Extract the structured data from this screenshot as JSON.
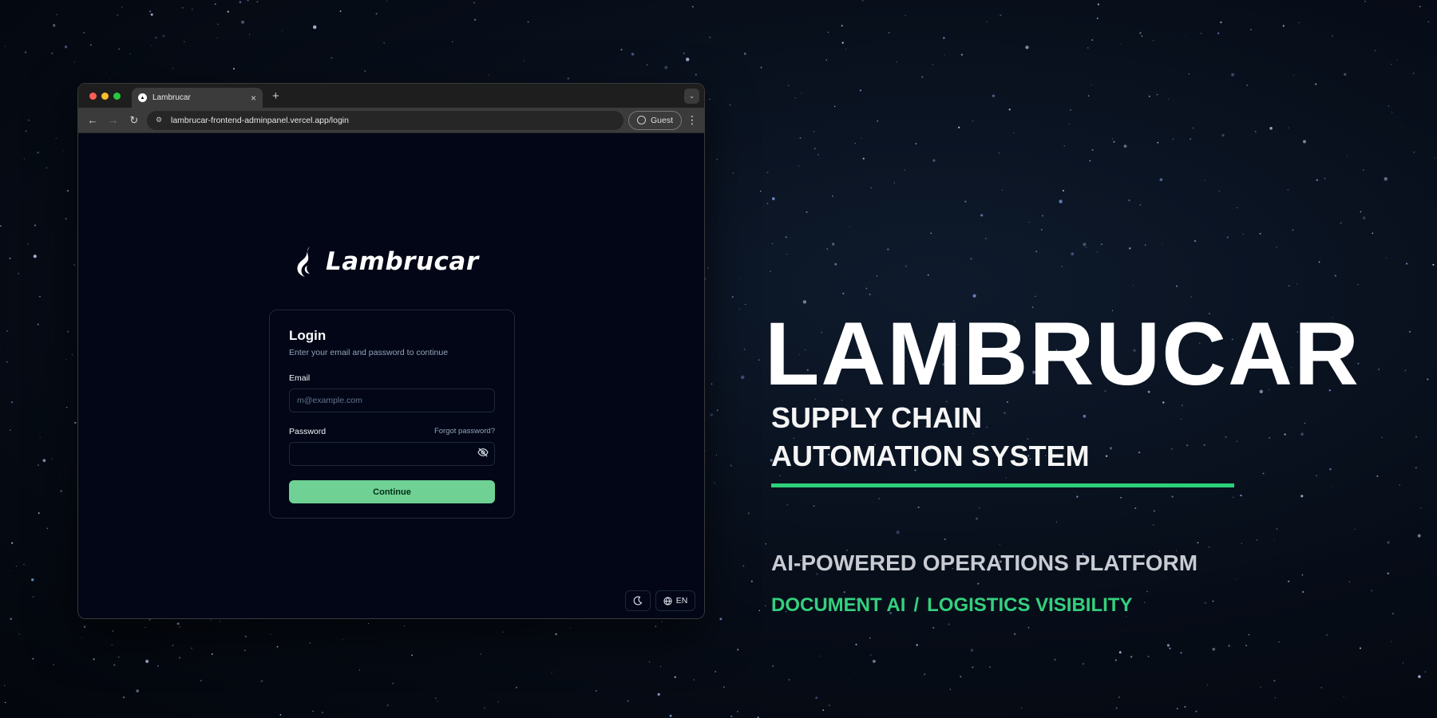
{
  "browser": {
    "tab_title": "Lambrucar",
    "tab_close": "×",
    "new_tab": "+",
    "url": "lambrucar-frontend-adminpanel.vercel.app/login",
    "profile_label": "Guest"
  },
  "login_page": {
    "brand_name": "Lambrucar",
    "title": "Login",
    "subtitle": "Enter your email and password to continue",
    "email_label": "Email",
    "email_placeholder": "m@example.com",
    "password_label": "Password",
    "forgot_password": "Forgot password?",
    "continue_label": "Continue",
    "language_label": "EN"
  },
  "hero": {
    "title": "LAMBRUCAR",
    "subtitle_line1": "SUPPLY CHAIN",
    "subtitle_line2": "AUTOMATION SYSTEM",
    "tagline": "AI-POWERED OPERATIONS PLATFORM",
    "feature_1": "DOCUMENT AI",
    "separator": "/",
    "feature_2": "LOGISTICS VISIBILITY"
  },
  "colors": {
    "accent": "#2dd07a",
    "button": "#6fd193",
    "page_background": "#020617"
  }
}
